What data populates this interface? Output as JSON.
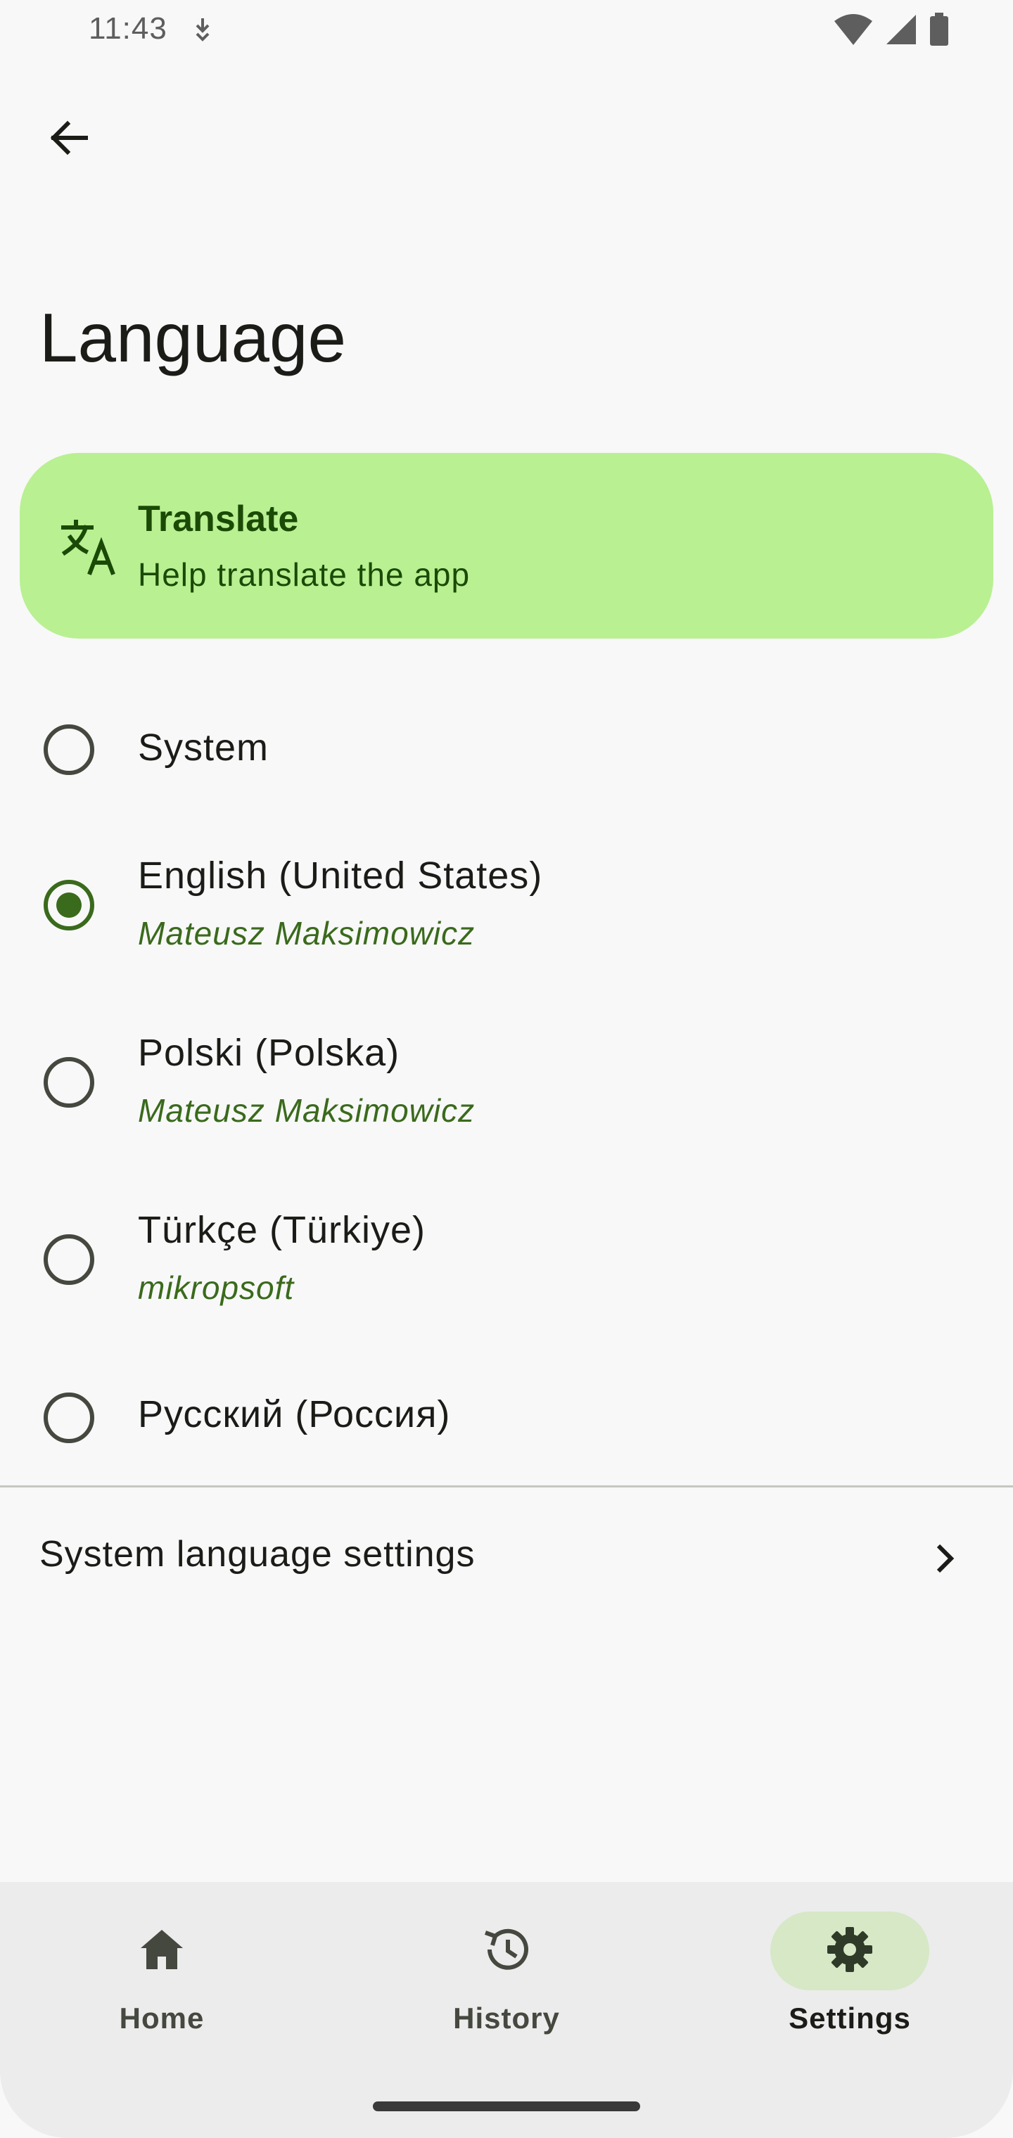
{
  "status_bar": {
    "time": "11:43",
    "icons": [
      "download-status-icon",
      "wifi-icon",
      "cell-signal-icon",
      "battery-icon"
    ]
  },
  "top_bar": {
    "back_icon": "arrow-back-icon",
    "title": "Language"
  },
  "translate_card": {
    "icon": "translate-icon",
    "title": "Translate",
    "subtitle": "Help translate the app",
    "background": "#b9f092"
  },
  "languages": [
    {
      "name": "System",
      "author": "",
      "selected": false
    },
    {
      "name": "English (United States)",
      "author": "Mateusz Maksimowicz",
      "selected": true
    },
    {
      "name": "Polski (Polska)",
      "author": "Mateusz Maksimowicz",
      "selected": false
    },
    {
      "name": "Türkçe (Türkiye)",
      "author": "mikropsoft",
      "selected": false
    },
    {
      "name": "Русский (Россия)",
      "author": "",
      "selected": false
    }
  ],
  "system_settings": {
    "label": "System language settings",
    "icon": "chevron-right-icon"
  },
  "bottom_nav": {
    "items": [
      {
        "label": "Home",
        "icon": "home-icon",
        "active": false
      },
      {
        "label": "History",
        "icon": "history-icon",
        "active": false
      },
      {
        "label": "Settings",
        "icon": "gear-icon",
        "active": true
      }
    ]
  },
  "colors": {
    "accent": "#3a6a1c",
    "card": "#b9f092",
    "nav_active_pill": "#d6e8c6",
    "background": "#f8f8f8"
  }
}
